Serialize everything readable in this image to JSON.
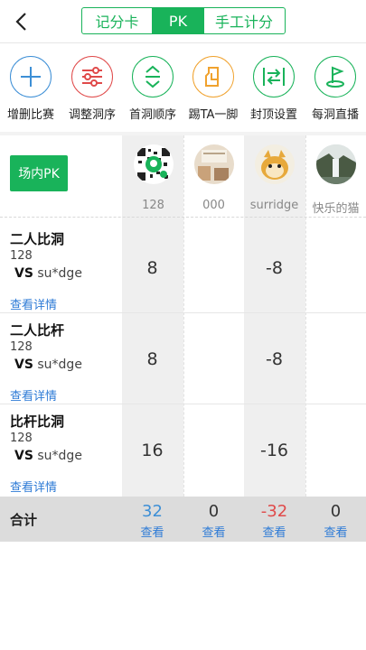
{
  "nav": {
    "back_icon": "chevron-left-icon",
    "tabs": [
      {
        "label": "记分卡",
        "active": false
      },
      {
        "label": "PK",
        "active": true
      },
      {
        "label": "手工计分",
        "active": false
      }
    ]
  },
  "toolbar": {
    "items": [
      {
        "label": "增删比赛",
        "icon": "plus-icon",
        "color": "#3d8fd6"
      },
      {
        "label": "调整洞序",
        "icon": "sliders-icon",
        "color": "#e04a4a"
      },
      {
        "label": "首洞顺序",
        "icon": "up-down-icon",
        "color": "#19b35a"
      },
      {
        "label": "踢TA一脚",
        "icon": "kick-icon",
        "color": "#f0a22e"
      },
      {
        "label": "封顶设置",
        "icon": "cap-arrows-icon",
        "color": "#19b35a"
      },
      {
        "label": "每洞直播",
        "icon": "golf-flag-icon",
        "color": "#19b35a"
      }
    ]
  },
  "pk_button": "场内PK",
  "players": [
    {
      "name": "128",
      "avatar": "qr-code-avatar"
    },
    {
      "name": "000",
      "avatar": "photo-avatar"
    },
    {
      "name": "surridge",
      "avatar": "cartoon-avatar"
    },
    {
      "name": "快乐的猫",
      "avatar": "waterfall-avatar"
    }
  ],
  "games": [
    {
      "title": "二人比洞",
      "player": "128",
      "vs_label": "VS",
      "opponent": "su*dge",
      "detail": "查看详情",
      "scores": [
        "8",
        "",
        "-8",
        ""
      ]
    },
    {
      "title": "二人比杆",
      "player": "128",
      "vs_label": "VS",
      "opponent": "su*dge",
      "detail": "查看详情",
      "scores": [
        "8",
        "",
        "-8",
        ""
      ]
    },
    {
      "title": "比杆比洞",
      "player": "128",
      "vs_label": "VS",
      "opponent": "su*dge",
      "detail": "查看详情",
      "scores": [
        "16",
        "",
        "-16",
        ""
      ]
    }
  ],
  "totals": {
    "label": "合计",
    "values": [
      "32",
      "0",
      "-32",
      "0"
    ],
    "colors": [
      "#3d8fd6",
      "#333333",
      "#e04a4a",
      "#333333"
    ],
    "view_label": "查看"
  }
}
